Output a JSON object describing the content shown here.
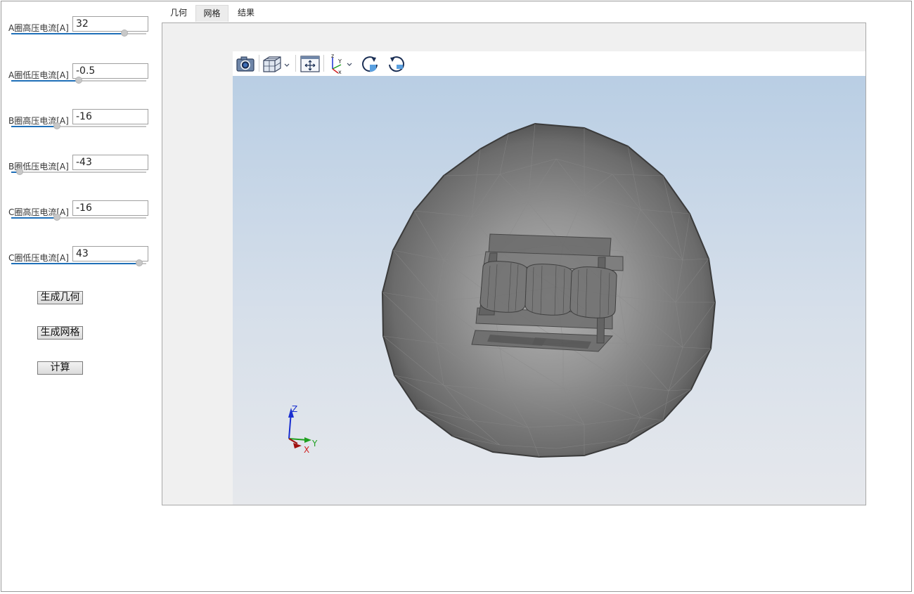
{
  "tabs": [
    {
      "label": "几何"
    },
    {
      "label": "网格"
    },
    {
      "label": "结果"
    }
  ],
  "active_tab": "网格",
  "parameters": [
    {
      "label": "A圈高压电流[A]",
      "value": "32",
      "slider": 0.84
    },
    {
      "label": "A圈低压电流[A]",
      "value": "-0.5",
      "slider": 0.5
    },
    {
      "label": "B圈高压电流[A]",
      "value": "-16",
      "slider": 0.34
    },
    {
      "label": "B圈低压电流[A]",
      "value": "-43",
      "slider": 0.06
    },
    {
      "label": "C圈高压电流[A]",
      "value": "-16",
      "slider": 0.34
    },
    {
      "label": "C圈低压电流[A]",
      "value": "43",
      "slider": 0.95
    }
  ],
  "buttons": {
    "generate_geometry": "生成几何",
    "generate_mesh": "生成网格",
    "compute": "计算"
  },
  "toolbar": {
    "icons": [
      "camera-icon",
      "view-cube-icon",
      "fit-all-icon",
      "axes-orientation-icon",
      "rotate-cw-icon",
      "rotate-ccw-icon"
    ]
  },
  "triad": {
    "x": "X",
    "y": "Y",
    "z": "Z"
  },
  "colors": {
    "slider_fill": "#1f6fb8",
    "axis_x": "#d02020",
    "axis_y": "#20a020",
    "axis_z": "#1a2fd0"
  }
}
